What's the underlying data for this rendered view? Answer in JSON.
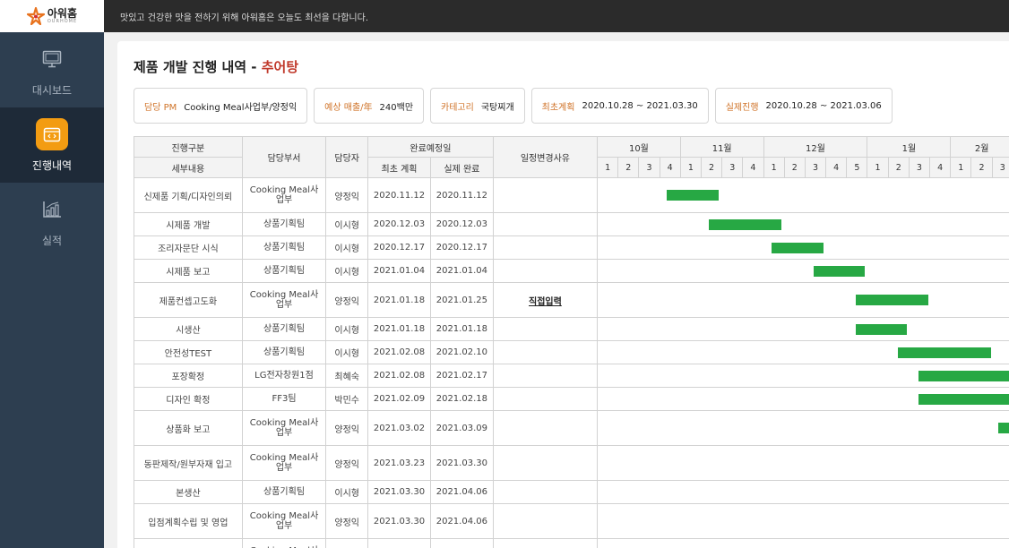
{
  "app": {
    "logo_text": "아워홈",
    "logo_sub": "OURHOME",
    "slogan": "맛있고 건강한 맛을 전하기 위해 아워홈은 오늘도 최선을 다합니다."
  },
  "sidebar": {
    "items": [
      {
        "label": "대시보드",
        "icon": "monitor-icon",
        "active": false
      },
      {
        "label": "진행내역",
        "icon": "calendar-icon",
        "active": true
      },
      {
        "label": "실적",
        "icon": "bar-chart-icon",
        "active": false
      }
    ]
  },
  "page": {
    "title": "제품 개발 진행 내역 - ",
    "title_accent": "추어탕"
  },
  "info": [
    {
      "key": "담당 PM",
      "value": "Cooking Meal사업부/양정익"
    },
    {
      "key": "예상 매출/年",
      "value": "240백만"
    },
    {
      "key": "카테고리",
      "value": "국탕찌개"
    },
    {
      "key": "최초계획",
      "value": "2020.10.28 ~ 2021.03.30"
    },
    {
      "key": "실제진행",
      "value": "2020.10.28 ~ 2021.03.06"
    }
  ],
  "table": {
    "headers": {
      "stage": "진행구분",
      "detail": "세부내용",
      "dept": "담당부서",
      "owner": "담당자",
      "due": "완료예정일",
      "plan": "최초 계획",
      "actual": "실제 완료",
      "reason": "일정변경사유"
    },
    "months": [
      {
        "label": "10월",
        "weeks": [
          "1",
          "2",
          "3",
          "4"
        ]
      },
      {
        "label": "11월",
        "weeks": [
          "1",
          "2",
          "3",
          "4"
        ]
      },
      {
        "label": "12월",
        "weeks": [
          "1",
          "2",
          "3",
          "4",
          "5"
        ]
      },
      {
        "label": "1월",
        "weeks": [
          "1",
          "2",
          "3",
          "4"
        ]
      },
      {
        "label": "2월",
        "weeks": [
          "1",
          "2",
          "3"
        ]
      }
    ],
    "rows": [
      {
        "task": "신제품 기획/디자인의뢰",
        "dept": "Cooking Meal사업부",
        "owner": "양정익",
        "plan": "2020.11.12",
        "actual": "2020.11.12",
        "reason": "",
        "bar_start_week": 3.3,
        "bar_weeks": 2.45
      },
      {
        "task": "시제품 개발",
        "dept": "상품기획팀",
        "owner": "이시형",
        "plan": "2020.12.03",
        "actual": "2020.12.03",
        "reason": "",
        "bar_start_week": 5.3,
        "bar_weeks": 3.45
      },
      {
        "task": "조리자문단 시식",
        "dept": "상품기획팀",
        "owner": "이시형",
        "plan": "2020.12.17",
        "actual": "2020.12.17",
        "reason": "",
        "bar_start_week": 8.3,
        "bar_weeks": 2.45
      },
      {
        "task": "시제품 보고",
        "dept": "상품기획팀",
        "owner": "이시형",
        "plan": "2021.01.04",
        "actual": "2021.01.04",
        "reason": "",
        "bar_start_week": 10.3,
        "bar_weeks": 2.45
      },
      {
        "task": "제품컨셉고도화",
        "dept": "Cooking Meal사업부",
        "owner": "양정익",
        "plan": "2021.01.18",
        "actual": "2021.01.25",
        "reason": "직접입력",
        "bar_start_week": 12.3,
        "bar_weeks": 3.45
      },
      {
        "task": "시생산",
        "dept": "상품기획팀",
        "owner": "이시형",
        "plan": "2021.01.18",
        "actual": "2021.01.18",
        "reason": "",
        "bar_start_week": 12.3,
        "bar_weeks": 2.45
      },
      {
        "task": "안전성TEST",
        "dept": "상품기획팀",
        "owner": "이시형",
        "plan": "2021.02.08",
        "actual": "2021.02.10",
        "reason": "",
        "bar_start_week": 14.3,
        "bar_weeks": 4.45
      },
      {
        "task": "포장확정",
        "dept": "LG전자창원1점",
        "owner": "최혜숙",
        "plan": "2021.02.08",
        "actual": "2021.02.17",
        "reason": "",
        "bar_start_week": 15.3,
        "bar_weeks": 5.0
      },
      {
        "task": "디자인 확정",
        "dept": "FF3팀",
        "owner": "박민수",
        "plan": "2021.02.09",
        "actual": "2021.02.18",
        "reason": "",
        "bar_start_week": 15.3,
        "bar_weeks": 5.0
      },
      {
        "task": "상품화 보고",
        "dept": "Cooking Meal사업부",
        "owner": "양정익",
        "plan": "2021.03.02",
        "actual": "2021.03.09",
        "reason": "",
        "bar_start_week": 19.1,
        "bar_weeks": 2.0
      },
      {
        "task": "동판제작/원부자재 입고",
        "dept": "Cooking Meal사업부",
        "owner": "양정익",
        "plan": "2021.03.23",
        "actual": "2021.03.30",
        "reason": "",
        "bar_start_week": null,
        "bar_weeks": 0
      },
      {
        "task": "본생산",
        "dept": "상품기획팀",
        "owner": "이시형",
        "plan": "2021.03.30",
        "actual": "2021.04.06",
        "reason": "",
        "bar_start_week": null,
        "bar_weeks": 0
      },
      {
        "task": "입점계획수립 및 영업",
        "dept": "Cooking Meal사업부",
        "owner": "양정익",
        "plan": "2021.03.30",
        "actual": "2021.04.06",
        "reason": "",
        "bar_start_week": null,
        "bar_weeks": 0
      },
      {
        "task": "",
        "dept": "Cooking Meal사업부",
        "owner": "",
        "plan": "",
        "actual": "",
        "reason": "",
        "bar_start_week": null,
        "bar_weeks": 0
      }
    ]
  },
  "colors": {
    "sidebar_bg": "#2d3e50",
    "topbar_bg": "#2b2b2b",
    "accent_orange": "#f39c12",
    "title_accent": "#c0392b",
    "info_key": "#d0742a",
    "gantt_bar": "#27a844"
  }
}
